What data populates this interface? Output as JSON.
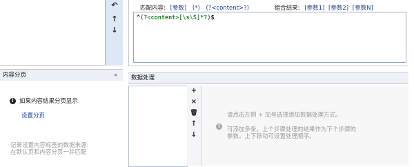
{
  "source_tools": {
    "move_up_icon": "↑",
    "move_down_icon": "↓",
    "return_icon": "↶"
  },
  "match_row": {
    "match_label": "匹配内容:",
    "param_link": "[参数]",
    "any_link": "(*)",
    "content_link": "(?<content>?)",
    "combine_label": "组合结果:",
    "param1_link": "[参数1]",
    "param2_link": "[参数2]",
    "paramN_link": "[参数N]"
  },
  "regex": {
    "caret": "^",
    "body": "(?<content>[\\s\\S]*?)",
    "dollar": "$"
  },
  "content_paging": {
    "title": "内容分页",
    "collapse_icon": "«",
    "info_text": "如果内容结果分页显示",
    "set_link": "设置分页",
    "note_line1": "记录设置内容标签的数据来源:",
    "note_line2": "在默认页和内容分页一并匹配"
  },
  "data_processing": {
    "title": "数据处理",
    "tools": {
      "add": "+",
      "remove": "×",
      "trash": "🗑",
      "up": "↑",
      "down": "↓"
    },
    "hint_line1": "请点击左侧 + 加号选择添加数据处理方式。",
    "hint_line2": "可添加多条，上个步骤处理的结果作为下个步骤的",
    "hint_line3": "参数。上下移动可设置处理顺序。"
  }
}
